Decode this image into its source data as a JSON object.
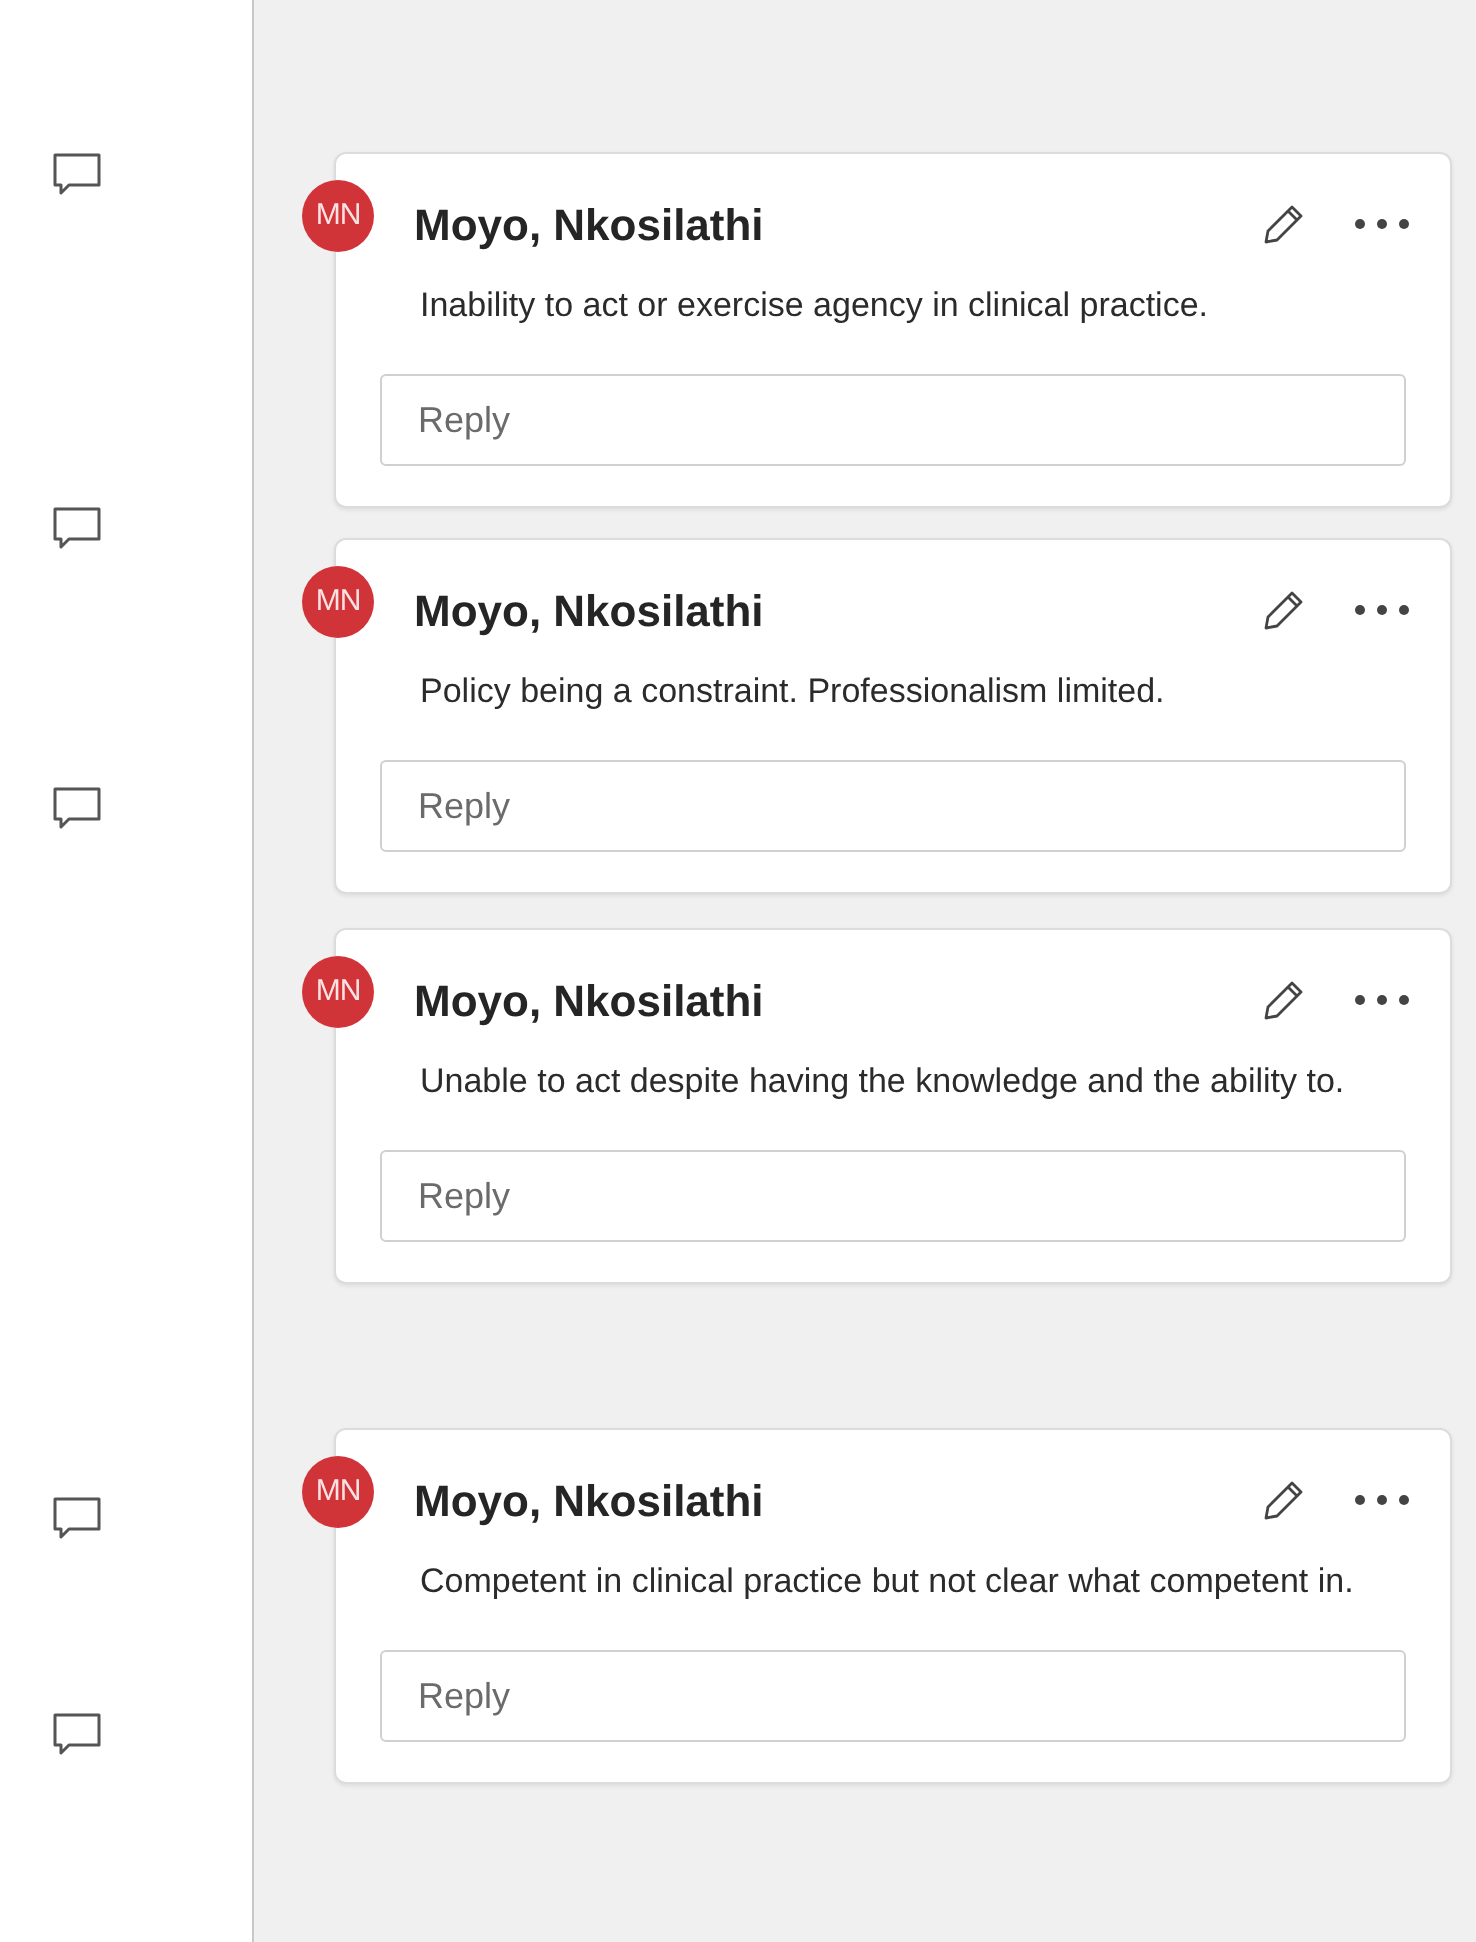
{
  "margin_markers": [
    {
      "kind": "comment"
    },
    {
      "kind": "comment"
    },
    {
      "kind": "comment"
    },
    {
      "kind": "comment"
    },
    {
      "kind": "comment"
    }
  ],
  "comments": [
    {
      "initials": "MN",
      "author": "Moyo, Nkosilathi",
      "text": "Inability to act or exercise agency in clinical practice.",
      "reply_placeholder": "Reply"
    },
    {
      "initials": "MN",
      "author": "Moyo, Nkosilathi",
      "text": "Policy being a constraint. Professionalism limited.",
      "reply_placeholder": "Reply"
    },
    {
      "initials": "MN",
      "author": "Moyo, Nkosilathi",
      "text": "Unable to act despite having the knowledge and the ability to.",
      "reply_placeholder": "Reply"
    },
    {
      "initials": "MN",
      "author": "Moyo, Nkosilathi",
      "text": "Competent in clinical practice but not clear what competent in.",
      "reply_placeholder": "Reply"
    }
  ]
}
